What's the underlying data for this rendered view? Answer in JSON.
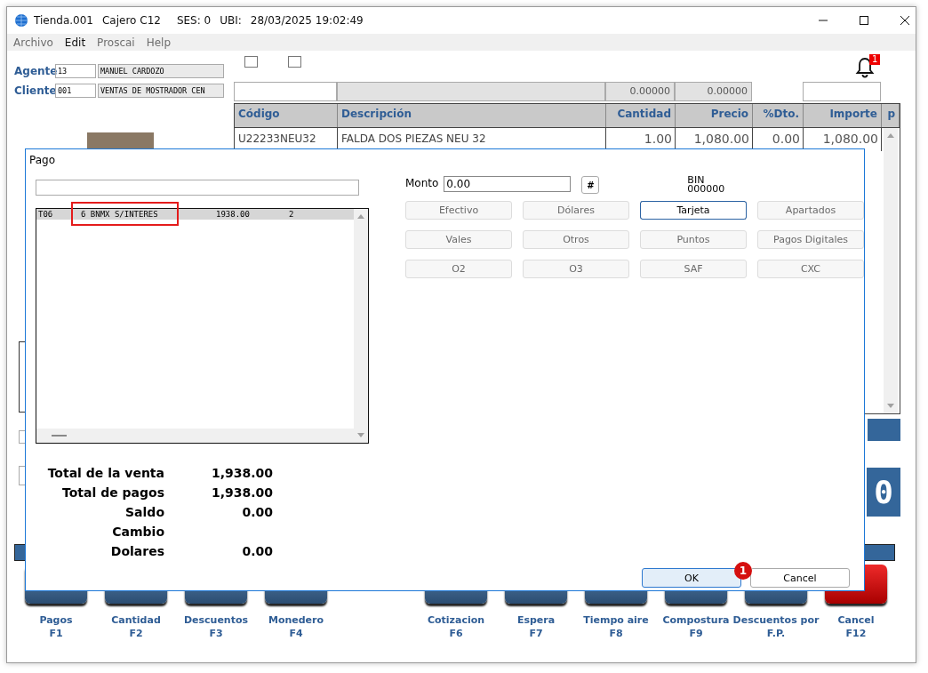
{
  "window": {
    "title_parts": [
      "Tienda.001",
      "Cajero C12",
      "SES: 0",
      "UBI:",
      "28/03/2025 19:02:49"
    ]
  },
  "menu": [
    {
      "label": "Archivo",
      "disabled": true
    },
    {
      "label": "Edit",
      "disabled": false
    },
    {
      "label": "Proscai",
      "disabled": true
    },
    {
      "label": "Help",
      "disabled": true
    }
  ],
  "agent": {
    "label": "Agente",
    "code": "13",
    "name": "MANUEL CARDOZO"
  },
  "client": {
    "label": "Cliente",
    "code": "001",
    "name": "VENTAS DE MOSTRADOR CEN"
  },
  "top_checkboxes": [
    {
      "checked": false
    },
    {
      "checked": false
    }
  ],
  "totals_row": [
    "0.00000",
    "0.00000"
  ],
  "notifications": {
    "count": "1"
  },
  "table": {
    "columns": [
      "Código",
      "Descripción",
      "Cantidad",
      "Precio",
      "%Dto.",
      "Importe",
      "p"
    ],
    "rows": [
      [
        "U22233NEU32",
        "FALDA DOS PIEZAS NEU 32",
        "1.00",
        "1,080.00",
        "0.00",
        "1,080.00"
      ]
    ]
  },
  "display": {
    "value": "0"
  },
  "function_keys": [
    {
      "kind": "normal",
      "label": "Pagos",
      "key": "F1"
    },
    {
      "kind": "normal",
      "label": "Cantidad",
      "key": "F2"
    },
    {
      "kind": "normal",
      "label": "Descuentos",
      "key": "F3"
    },
    {
      "kind": "normal",
      "label": "Monedero",
      "key": "F4"
    },
    {
      "kind": "blank"
    },
    {
      "kind": "normal",
      "label": "Cotizacion",
      "key": "F6"
    },
    {
      "kind": "normal",
      "label": "Espera",
      "key": "F7"
    },
    {
      "kind": "normal",
      "label": "Tiempo aire",
      "key": "F8"
    },
    {
      "kind": "normal",
      "label": "Compostura",
      "key": "F9"
    },
    {
      "kind": "normal",
      "label": "Descuentos por",
      "key": "F.P."
    },
    {
      "kind": "cancel",
      "label": "Cancel",
      "key": "F12"
    }
  ],
  "dialog": {
    "title": "Pago",
    "payments": [
      {
        "code": "T06",
        "description": "6 BNMX S/INTERES",
        "amount": "1938.00",
        "count": "2",
        "highlighted": true
      }
    ],
    "amount_label": "Monto",
    "amount_value": "0.00",
    "hash_button": "#",
    "bin_label": "BIN",
    "bin_value": "000000",
    "methods": [
      {
        "label": "Efectivo",
        "selected": false
      },
      {
        "label": "Dólares",
        "selected": false
      },
      {
        "label": "Tarjeta",
        "selected": true
      },
      {
        "label": "Apartados",
        "selected": false
      },
      {
        "label": "Vales",
        "selected": false
      },
      {
        "label": "Otros",
        "selected": false
      },
      {
        "label": "Puntos",
        "selected": false
      },
      {
        "label": "Pagos Digitales",
        "selected": false
      },
      {
        "label": "O2",
        "selected": false
      },
      {
        "label": "O3",
        "selected": false
      },
      {
        "label": "SAF",
        "selected": false
      },
      {
        "label": "CXC",
        "selected": false
      }
    ],
    "totals": [
      {
        "label": "Total de la venta",
        "value": "1,938.00"
      },
      {
        "label": "Total de pagos",
        "value": "1,938.00"
      },
      {
        "label": "Saldo",
        "value": "0.00"
      },
      {
        "label": "Cambio"
      },
      {
        "label": "Dolares",
        "value": "0.00"
      }
    ],
    "ok_button": "OK",
    "ok_marker": "1",
    "cancel_button": "Cancel"
  }
}
